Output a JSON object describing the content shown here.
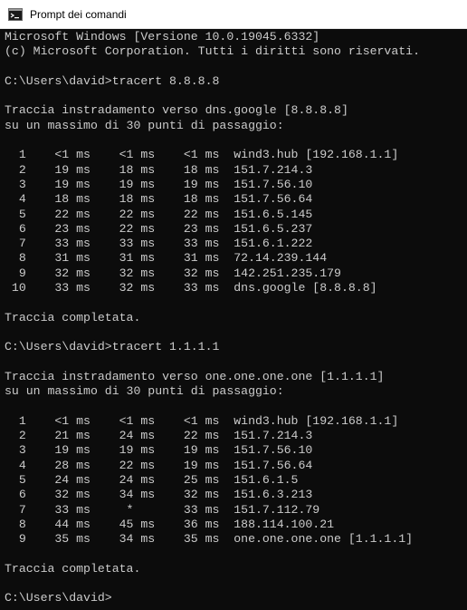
{
  "window": {
    "title": "Prompt dei comandi",
    "icon": "cmd-icon",
    "colors": {
      "console_background": "#0c0c0c",
      "console_text": "#cccccc",
      "titlebar_background": "#ffffff"
    }
  },
  "console": {
    "lines": [
      "Microsoft Windows [Versione 10.0.19045.6332]",
      "(c) Microsoft Corporation. Tutti i diritti sono riservati.",
      "",
      "C:\\Users\\david>tracert 8.8.8.8",
      "",
      "Traccia instradamento verso dns.google [8.8.8.8]",
      "su un massimo di 30 punti di passaggio:",
      "",
      "  1    <1 ms    <1 ms    <1 ms  wind3.hub [192.168.1.1]",
      "  2    19 ms    18 ms    18 ms  151.7.214.3",
      "  3    19 ms    19 ms    19 ms  151.7.56.10",
      "  4    18 ms    18 ms    18 ms  151.7.56.64",
      "  5    22 ms    22 ms    22 ms  151.6.5.145",
      "  6    23 ms    22 ms    23 ms  151.6.5.237",
      "  7    33 ms    33 ms    33 ms  151.6.1.222",
      "  8    31 ms    31 ms    31 ms  72.14.239.144",
      "  9    32 ms    32 ms    32 ms  142.251.235.179",
      " 10    33 ms    32 ms    33 ms  dns.google [8.8.8.8]",
      "",
      "Traccia completata.",
      "",
      "C:\\Users\\david>tracert 1.1.1.1",
      "",
      "Traccia instradamento verso one.one.one.one [1.1.1.1]",
      "su un massimo di 30 punti di passaggio:",
      "",
      "  1    <1 ms    <1 ms    <1 ms  wind3.hub [192.168.1.1]",
      "  2    21 ms    24 ms    22 ms  151.7.214.3",
      "  3    19 ms    19 ms    19 ms  151.7.56.10",
      "  4    28 ms    22 ms    19 ms  151.7.56.64",
      "  5    24 ms    24 ms    25 ms  151.6.1.5",
      "  6    32 ms    34 ms    32 ms  151.6.3.213",
      "  7    33 ms     *       33 ms  151.7.112.79",
      "  8    44 ms    45 ms    36 ms  188.114.100.21",
      "  9    35 ms    34 ms    35 ms  one.one.one.one [1.1.1.1]",
      "",
      "Traccia completata.",
      "",
      "C:\\Users\\david>"
    ]
  }
}
